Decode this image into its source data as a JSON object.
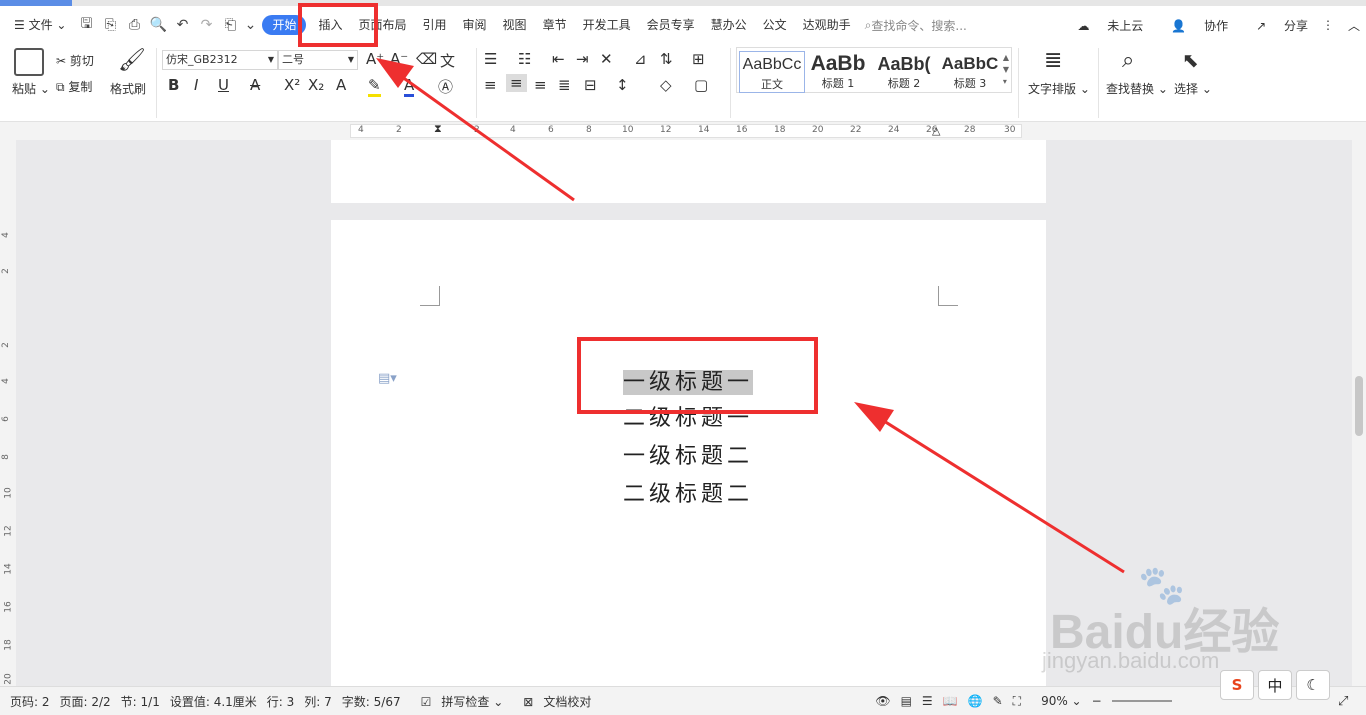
{
  "menu": {
    "file": "文件",
    "tabs": [
      "开始",
      "插入",
      "页面布局",
      "引用",
      "审阅",
      "视图",
      "章节",
      "开发工具",
      "会员专享",
      "慧办公",
      "公文",
      "达观助手"
    ],
    "search_placeholder": "查找命令、搜索...",
    "cloud": "未上云",
    "collab": "协作",
    "share": "分享"
  },
  "ribbon": {
    "paste": "粘贴",
    "cut": "剪切",
    "copy": "复制",
    "format_painter": "格式刷",
    "font_name": "仿宋_GB2312",
    "font_size": "二号",
    "styles": [
      {
        "preview": "AaBbCc",
        "label": "正文"
      },
      {
        "preview": "AaBb",
        "label": "标题 1"
      },
      {
        "preview": "AaBb(",
        "label": "标题 2"
      },
      {
        "preview": "AaBbC",
        "label": "标题 3"
      }
    ],
    "text_layout": "文字排版",
    "find_replace": "查找替换",
    "select": "选择"
  },
  "ruler": {
    "h_ticks": [
      "4",
      "2",
      "2",
      "4",
      "6",
      "8",
      "10",
      "12",
      "14",
      "16",
      "18",
      "20",
      "22",
      "24",
      "26",
      "28",
      "30"
    ],
    "v_ticks": [
      "4",
      "2",
      "2",
      "4",
      "6",
      "8",
      "10",
      "12",
      "14",
      "16",
      "18",
      "20"
    ]
  },
  "document": {
    "lines": [
      "一级标题一",
      "二级标题一",
      "一级标题二",
      "二级标题二"
    ]
  },
  "status": {
    "page_num": "页码: 2",
    "pages": "页面: 2/2",
    "section": "节: 1/1",
    "setting": "设置值: 4.1厘米",
    "row": "行: 3",
    "col": "列: 7",
    "words": "字数: 5/67",
    "spell": "拼写检查",
    "proof": "文档校对",
    "zoom": "90%"
  },
  "ime": {
    "cn": "中"
  },
  "watermark": {
    "brand": "Baidu经验",
    "url": "jingyan.baidu.com"
  },
  "colors": {
    "accent": "#3a7bf2",
    "annotation": "#ee2f2f",
    "highlight": "#c8c8c8"
  }
}
